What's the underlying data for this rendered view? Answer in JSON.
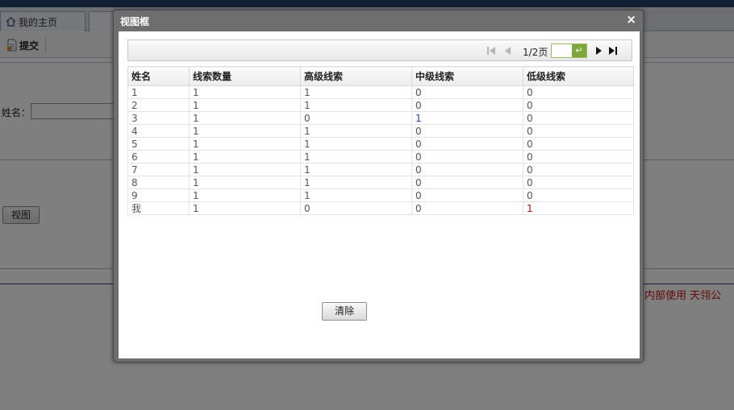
{
  "tabs": [
    {
      "label": "我的主页",
      "icon": "home-icon"
    },
    {
      "label": "",
      "icon": "close-icon"
    }
  ],
  "toolbar": {
    "submit_label": "提交",
    "submit_icon": "document-icon"
  },
  "form": {
    "name_label": "姓名：",
    "name_value": "",
    "view_button": "视图"
  },
  "footer_text": "户内部使用 天翎公",
  "dialog": {
    "title": "视图框",
    "close_glyph": "×",
    "pager": {
      "page_text": "1/2页",
      "page_input": "",
      "go_glyph": "↵"
    },
    "columns": [
      "姓名",
      "线索数量",
      "高级线索",
      "中级线索",
      "低级线索"
    ],
    "rows": [
      [
        "1",
        "1",
        "1",
        "0",
        "0"
      ],
      [
        "2",
        "1",
        "1",
        "0",
        "0"
      ],
      [
        "3",
        "1",
        "0",
        "1",
        "0"
      ],
      [
        "4",
        "1",
        "1",
        "0",
        "0"
      ],
      [
        "5",
        "1",
        "1",
        "0",
        "0"
      ],
      [
        "6",
        "1",
        "1",
        "0",
        "0"
      ],
      [
        "7",
        "1",
        "1",
        "0",
        "0"
      ],
      [
        "8",
        "1",
        "1",
        "0",
        "0"
      ],
      [
        "9",
        "1",
        "1",
        "0",
        "0"
      ],
      [
        "我",
        "1",
        "0",
        "0",
        "1"
      ]
    ],
    "clear_button": "清除"
  },
  "colors": {
    "accent_dark": "#25406a",
    "footer_red": "#cc1111",
    "pager_go": "#7ea63a"
  }
}
